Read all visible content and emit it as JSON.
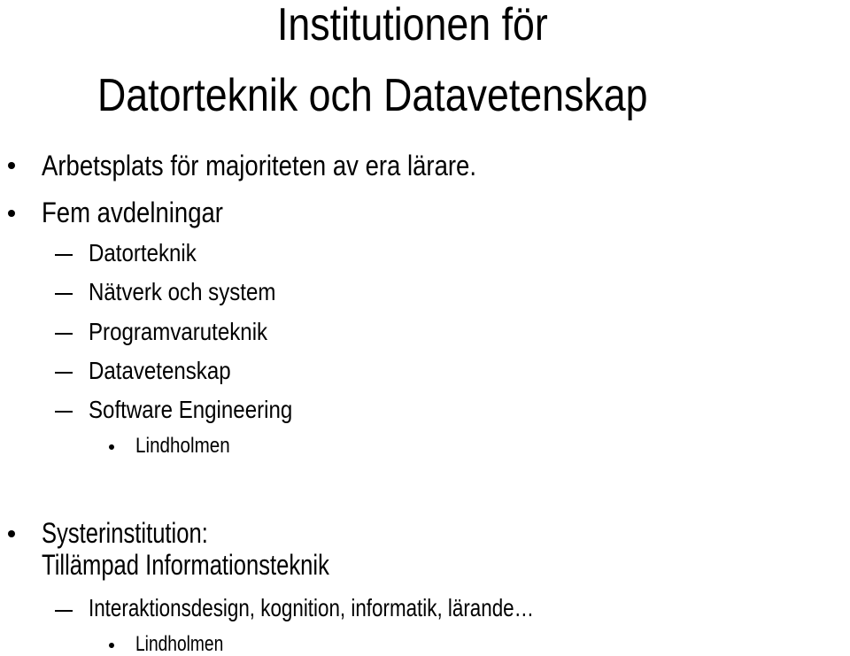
{
  "slide": {
    "title_line1": "Institutionen för",
    "title_line2": "Datorteknik och Datavetenskap",
    "bullets": [
      {
        "text": "Arbetsplats för majoriteten av era lärare."
      },
      {
        "text": "Fem avdelningar",
        "sub": [
          "Datorteknik",
          "Nätverk och system",
          "Programvaruteknik",
          "Datavetenskap",
          "Software Engineering"
        ],
        "subsub": "Lindholmen"
      },
      {
        "text_line1": "Systerinstitution:",
        "text_line2": "Tillämpad Informationsteknik",
        "sub": "Interaktionsdesign, kognition, informatik, lärande…",
        "subsub": "Lindholmen"
      }
    ]
  }
}
